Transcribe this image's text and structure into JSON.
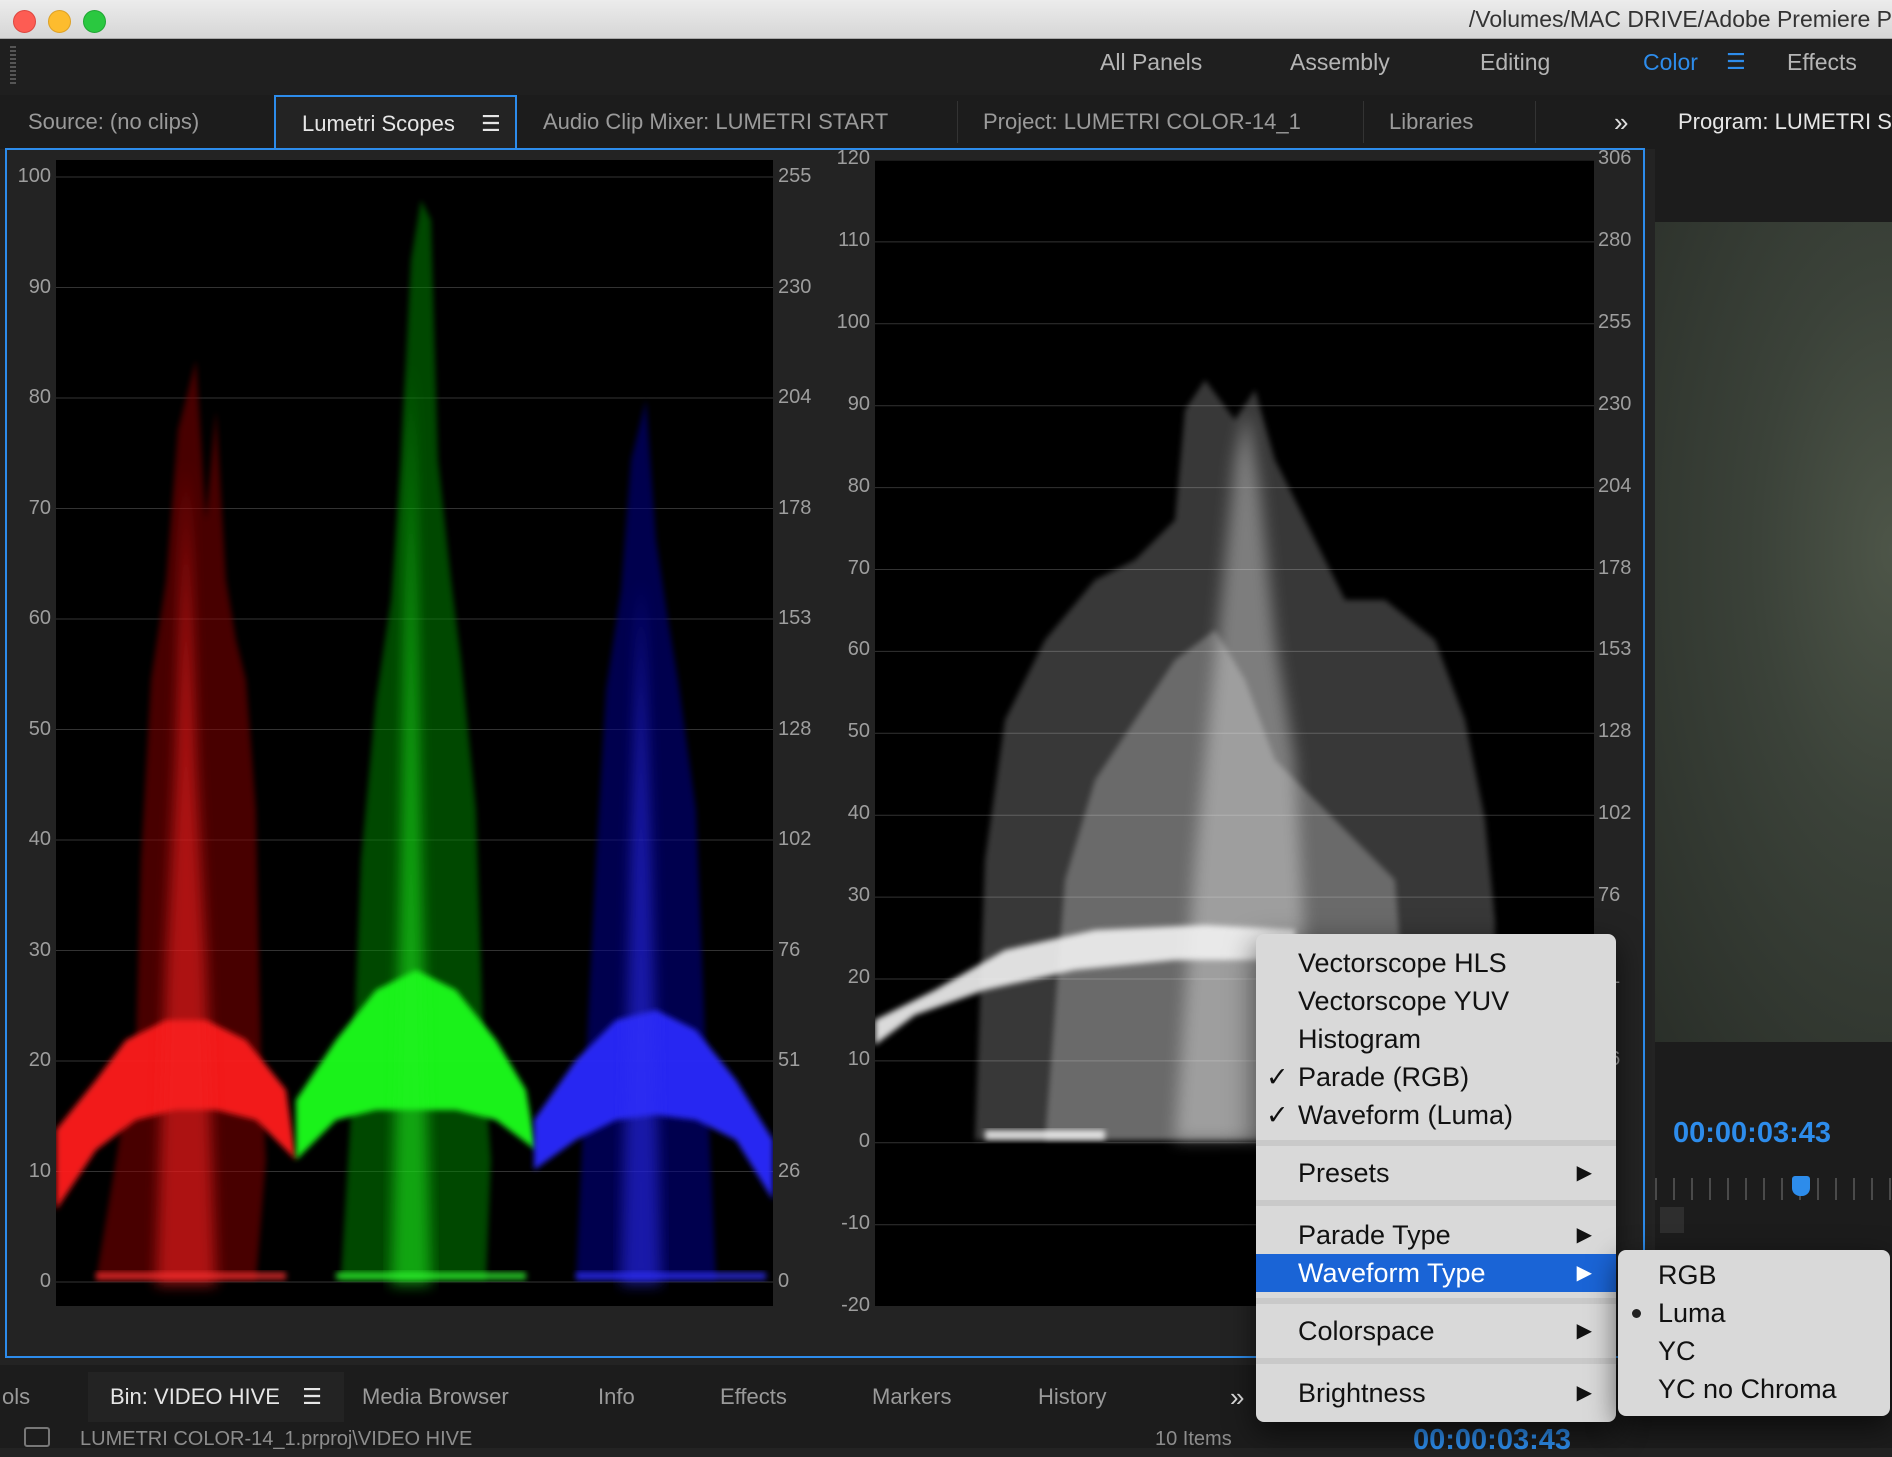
{
  "window": {
    "title": "/Volumes/MAC DRIVE/Adobe Premiere P"
  },
  "workspaces": [
    {
      "label": "All Panels",
      "active": false
    },
    {
      "label": "Assembly",
      "active": false
    },
    {
      "label": "Editing",
      "active": false
    },
    {
      "label": "Color",
      "active": true
    },
    {
      "label": "Effects",
      "active": false
    }
  ],
  "panel_menu_glyph": "☰",
  "tabs": {
    "source": "Source: (no clips)",
    "lumetri": "Lumetri Scopes",
    "audio": "Audio Clip Mixer: LUMETRI START",
    "project": "Project: LUMETRI COLOR-14_1",
    "libraries": "Libraries",
    "overflow": "»",
    "program": "Program: LUMETRI S"
  },
  "parade": {
    "left_axis": [
      "100",
      "90",
      "80",
      "70",
      "60",
      "50",
      "40",
      "30",
      "20",
      "10",
      "0"
    ],
    "right_axis": [
      "255",
      "230",
      "204",
      "178",
      "153",
      "128",
      "102",
      "76",
      "51",
      "26",
      "0"
    ],
    "colors": {
      "red": "#ff1a1a",
      "green": "#1aff1a",
      "blue": "#2a2aff"
    }
  },
  "waveform": {
    "left_axis": [
      "120",
      "110",
      "100",
      "90",
      "80",
      "70",
      "60",
      "50",
      "40",
      "30",
      "20",
      "10",
      "0",
      "-10",
      "-20"
    ],
    "right_axis": [
      "306",
      "280",
      "255",
      "230",
      "204",
      "178",
      "153",
      "128",
      "102",
      "76",
      "51",
      "26",
      "6"
    ]
  },
  "context_menu": {
    "items": [
      {
        "label": "Vectorscope HLS",
        "checked": false,
        "submenu": false
      },
      {
        "label": "Vectorscope YUV",
        "checked": false,
        "submenu": false
      },
      {
        "label": "Histogram",
        "checked": false,
        "submenu": false
      },
      {
        "label": "Parade (RGB)",
        "checked": true,
        "submenu": false
      },
      {
        "label": "Waveform (Luma)",
        "checked": true,
        "submenu": false
      },
      {
        "label": "Presets",
        "checked": false,
        "submenu": true
      },
      {
        "label": "Parade Type",
        "checked": false,
        "submenu": true
      },
      {
        "label": "Waveform Type",
        "checked": false,
        "submenu": true,
        "highlighted": true
      },
      {
        "label": "Colorspace",
        "checked": false,
        "submenu": true
      },
      {
        "label": "Brightness",
        "checked": false,
        "submenu": true
      }
    ],
    "check_glyph": "✓",
    "arrow_glyph": "▶"
  },
  "submenu": {
    "items": [
      {
        "label": "RGB",
        "selected": false
      },
      {
        "label": "Luma",
        "selected": true
      },
      {
        "label": "YC",
        "selected": false
      },
      {
        "label": "YC no Chroma",
        "selected": false
      }
    ]
  },
  "program_monitor": {
    "timecode": "00:00:03:43"
  },
  "bottom_tabs": {
    "tools": "ols",
    "bin": "Bin: VIDEO HIVE",
    "media_browser": "Media Browser",
    "info": "Info",
    "effects": "Effects",
    "markers": "Markers",
    "history": "History",
    "overflow": "»"
  },
  "bin": {
    "path": "LUMETRI COLOR-14_1.prproj\\VIDEO HIVE",
    "count": "10 Items"
  },
  "timeline": {
    "timecode": "00:00:03:43"
  }
}
